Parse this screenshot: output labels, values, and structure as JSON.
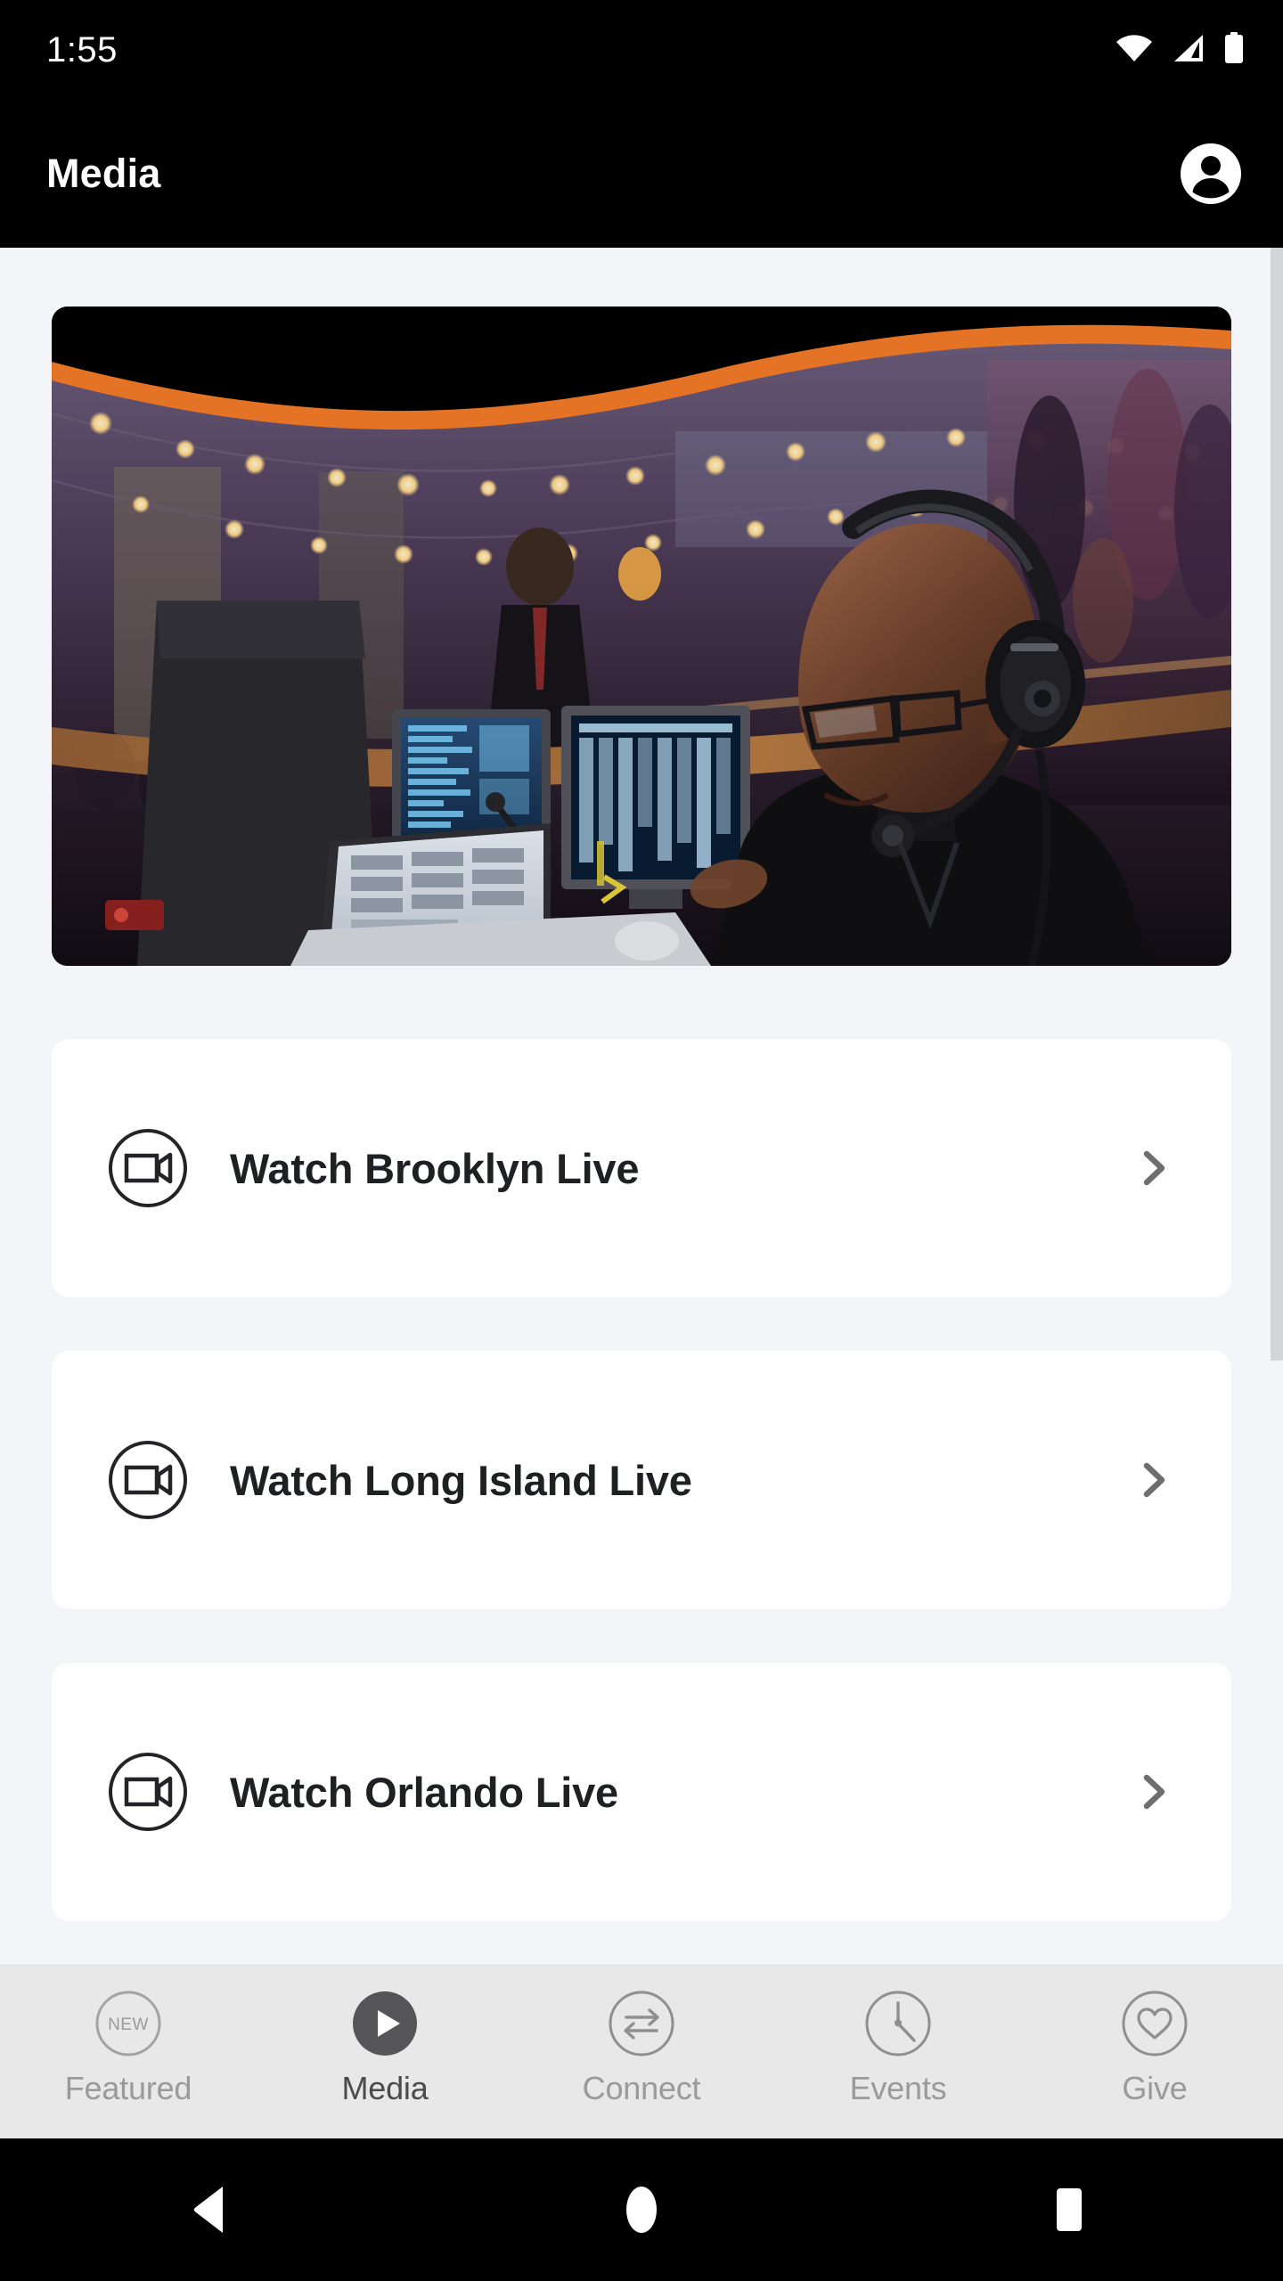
{
  "status_bar": {
    "time": "1:55",
    "icons": [
      "wifi-icon",
      "cellular-signal-icon",
      "battery-icon"
    ]
  },
  "app_bar": {
    "title": "Media",
    "account_icon": "account-circle-icon"
  },
  "hero": {
    "description": "Audio engineer with headset at production console in church venue with string lights and orange arc banner",
    "accent_color": "#F47B29"
  },
  "media_list": [
    {
      "label": "Watch Brooklyn Live",
      "icon": "video-camera-icon",
      "chevron": "chevron-right-icon"
    },
    {
      "label": "Watch Long Island Live",
      "icon": "video-camera-icon",
      "chevron": "chevron-right-icon"
    },
    {
      "label": "Watch Orlando Live",
      "icon": "video-camera-icon",
      "chevron": "chevron-right-icon"
    }
  ],
  "bottom_nav": {
    "items": [
      {
        "label": "Featured",
        "icon": "new-badge-icon",
        "active": false
      },
      {
        "label": "Media",
        "icon": "play-circle-icon",
        "active": true
      },
      {
        "label": "Connect",
        "icon": "exchange-arrows-icon",
        "active": false
      },
      {
        "label": "Events",
        "icon": "clock-icon",
        "active": false
      },
      {
        "label": "Give",
        "icon": "heart-icon",
        "active": false
      }
    ],
    "featured_badge_text": "NEW",
    "active_color": "#4b4b4b",
    "inactive_color": "#9a9a9a"
  },
  "android_nav": {
    "back": "back-triangle-icon",
    "home": "home-circle-icon",
    "recents": "recents-square-icon"
  },
  "colors": {
    "app_bar_bg": "#000000",
    "page_bg": "#f4f5f9",
    "card_bg": "#ffffff",
    "text_primary": "#1f2024",
    "chevron": "#6e6e6e",
    "nav_bg": "#e8e8e8"
  }
}
